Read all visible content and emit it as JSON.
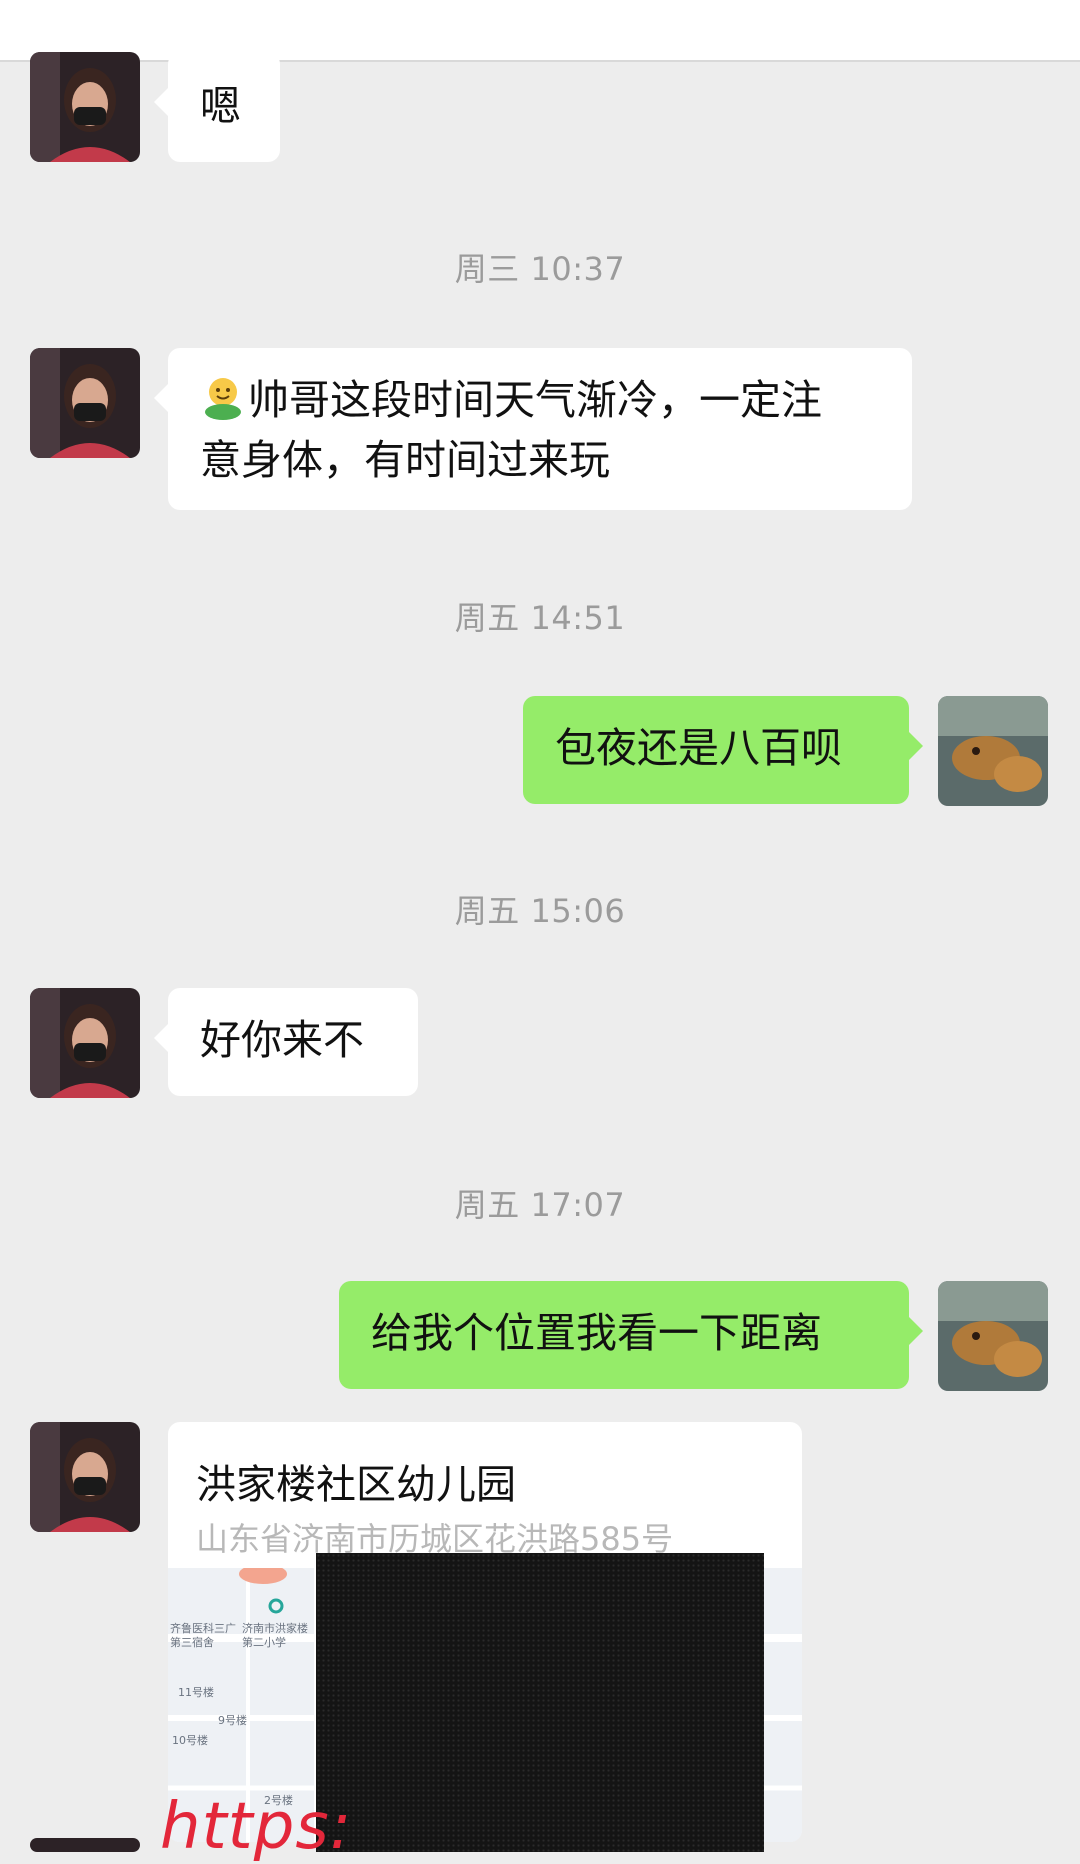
{
  "messages": [
    {
      "id": "m1",
      "text": "嗯"
    },
    {
      "id": "t1",
      "time": "周三 10:37"
    },
    {
      "id": "m2",
      "line1": "帅哥这段时间天气渐冷，一定注",
      "line2": "意身体，有时间过来玩",
      "emoji": "smiley-hug-emoji"
    },
    {
      "id": "t2",
      "time": "周五 14:51"
    },
    {
      "id": "m3",
      "text": "包夜还是八百呗"
    },
    {
      "id": "t3",
      "time": "周五 15:06"
    },
    {
      "id": "m4",
      "text": "好你来不"
    },
    {
      "id": "t4",
      "time": "周五 17:07"
    },
    {
      "id": "m5",
      "text": "给我个位置我看一下距离"
    }
  ],
  "location": {
    "title": "洪家楼社区幼儿园",
    "address": "山东省济南市历城区花洪路585号",
    "map_labels": [
      "济南市洪家楼第二小学",
      "齐鲁医科三广第三宿舍",
      "11号楼",
      "9号楼",
      "10号楼",
      "2号楼"
    ]
  },
  "watermark": "https:",
  "colors": {
    "background": "#ededed",
    "incoming": "#ffffff",
    "outgoing": "#95ec69",
    "time": "#9b9b9b"
  }
}
